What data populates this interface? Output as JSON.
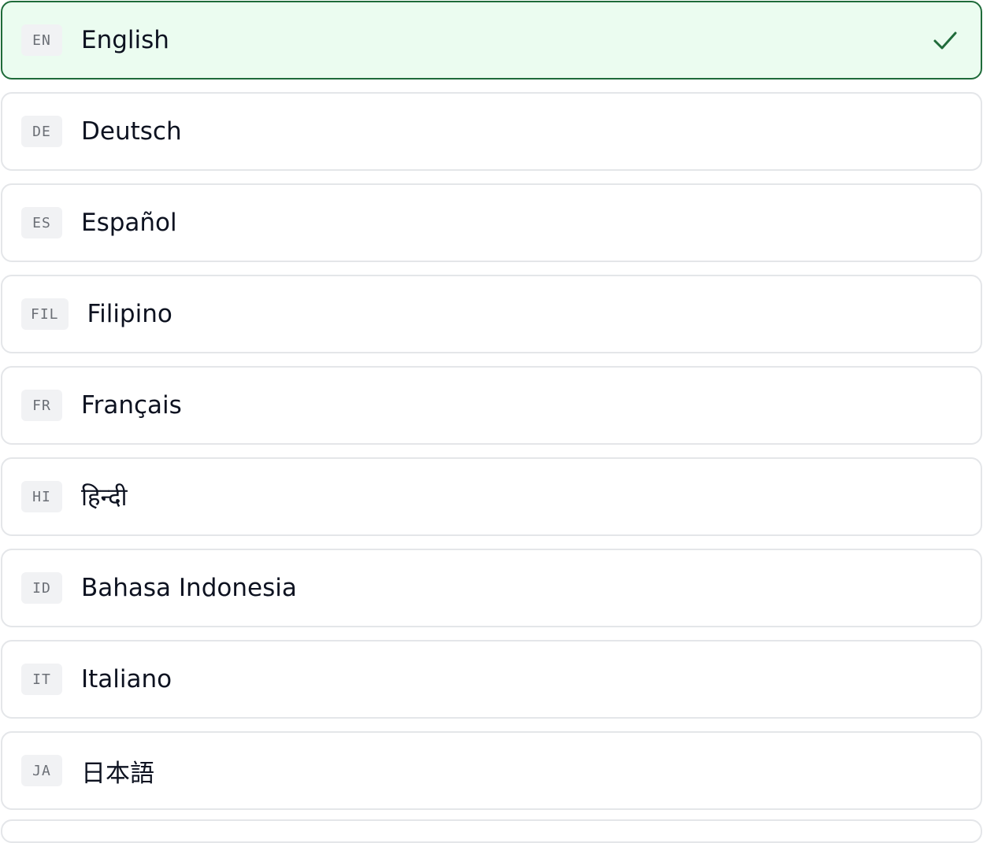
{
  "languages": [
    {
      "code": "EN",
      "label": "English",
      "selected": true
    },
    {
      "code": "DE",
      "label": "Deutsch",
      "selected": false
    },
    {
      "code": "ES",
      "label": "Español",
      "selected": false
    },
    {
      "code": "FIL",
      "label": "Filipino",
      "selected": false
    },
    {
      "code": "FR",
      "label": "Français",
      "selected": false
    },
    {
      "code": "HI",
      "label": "हिन्दी",
      "selected": false
    },
    {
      "code": "ID",
      "label": "Bahasa Indonesia",
      "selected": false
    },
    {
      "code": "IT",
      "label": "Italiano",
      "selected": false
    },
    {
      "code": "JA",
      "label": "日本語",
      "selected": false
    }
  ],
  "icons": {
    "selected": "check-icon"
  },
  "colors": {
    "selected_background": "#ebfcf0",
    "selected_border": "#1f6b3a",
    "check": "#1f6b3a",
    "item_border": "#e4e6e9",
    "code_badge_background": "#f1f2f4",
    "code_text": "#6b6f76",
    "label_text": "#0d1220"
  }
}
